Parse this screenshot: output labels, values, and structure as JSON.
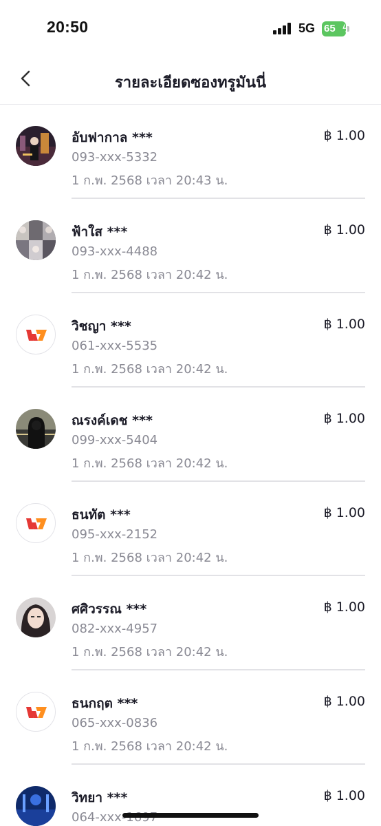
{
  "status_bar": {
    "time": "20:50",
    "network": "5G",
    "battery": "65"
  },
  "header": {
    "title": "รายละเอียดซองทรูมันนี่"
  },
  "colors": {
    "accent_red": "#e53935",
    "accent_orange": "#ff8f1f",
    "battery_green": "#5cc660"
  },
  "transactions": [
    {
      "name": "อับฟากาล ***",
      "phone": "093-xxx-5332",
      "date": "1 ก.พ. 2568 เวลา 20:43 น.",
      "amount": "฿ 1.00",
      "avatar": "photo-night-city"
    },
    {
      "name": "ฟ้าใส ***",
      "phone": "093-xxx-4488",
      "date": "1 ก.พ. 2568 เวลา 20:42 น.",
      "amount": "฿ 1.00",
      "avatar": "photo-collage"
    },
    {
      "name": "วิชญา ***",
      "phone": "061-xxx-5535",
      "date": "1 ก.พ. 2568 เวลา 20:42 น.",
      "amount": "฿ 1.00",
      "avatar": "truemoney-logo"
    },
    {
      "name": "ณรงค์เดช ***",
      "phone": "099-xxx-5404",
      "date": "1 ก.พ. 2568 เวลา 20:42 น.",
      "amount": "฿ 1.00",
      "avatar": "photo-hoodie"
    },
    {
      "name": "ธนทัต ***",
      "phone": "095-xxx-2152",
      "date": "1 ก.พ. 2568 เวลา 20:42 น.",
      "amount": "฿ 1.00",
      "avatar": "truemoney-logo"
    },
    {
      "name": "ศศิวรรณ ***",
      "phone": "082-xxx-4957",
      "date": "1 ก.พ. 2568 เวลา 20:42 น.",
      "amount": "฿ 1.00",
      "avatar": "photo-portrait"
    },
    {
      "name": "ธนกฤต ***",
      "phone": "065-xxx-0836",
      "date": "1 ก.พ. 2568 เวลา 20:42 น.",
      "amount": "฿ 1.00",
      "avatar": "truemoney-logo"
    },
    {
      "name": "วิทยา ***",
      "phone": "064-xxx-1697",
      "date": "",
      "amount": "฿ 1.00",
      "avatar": "photo-blue-scene"
    }
  ]
}
